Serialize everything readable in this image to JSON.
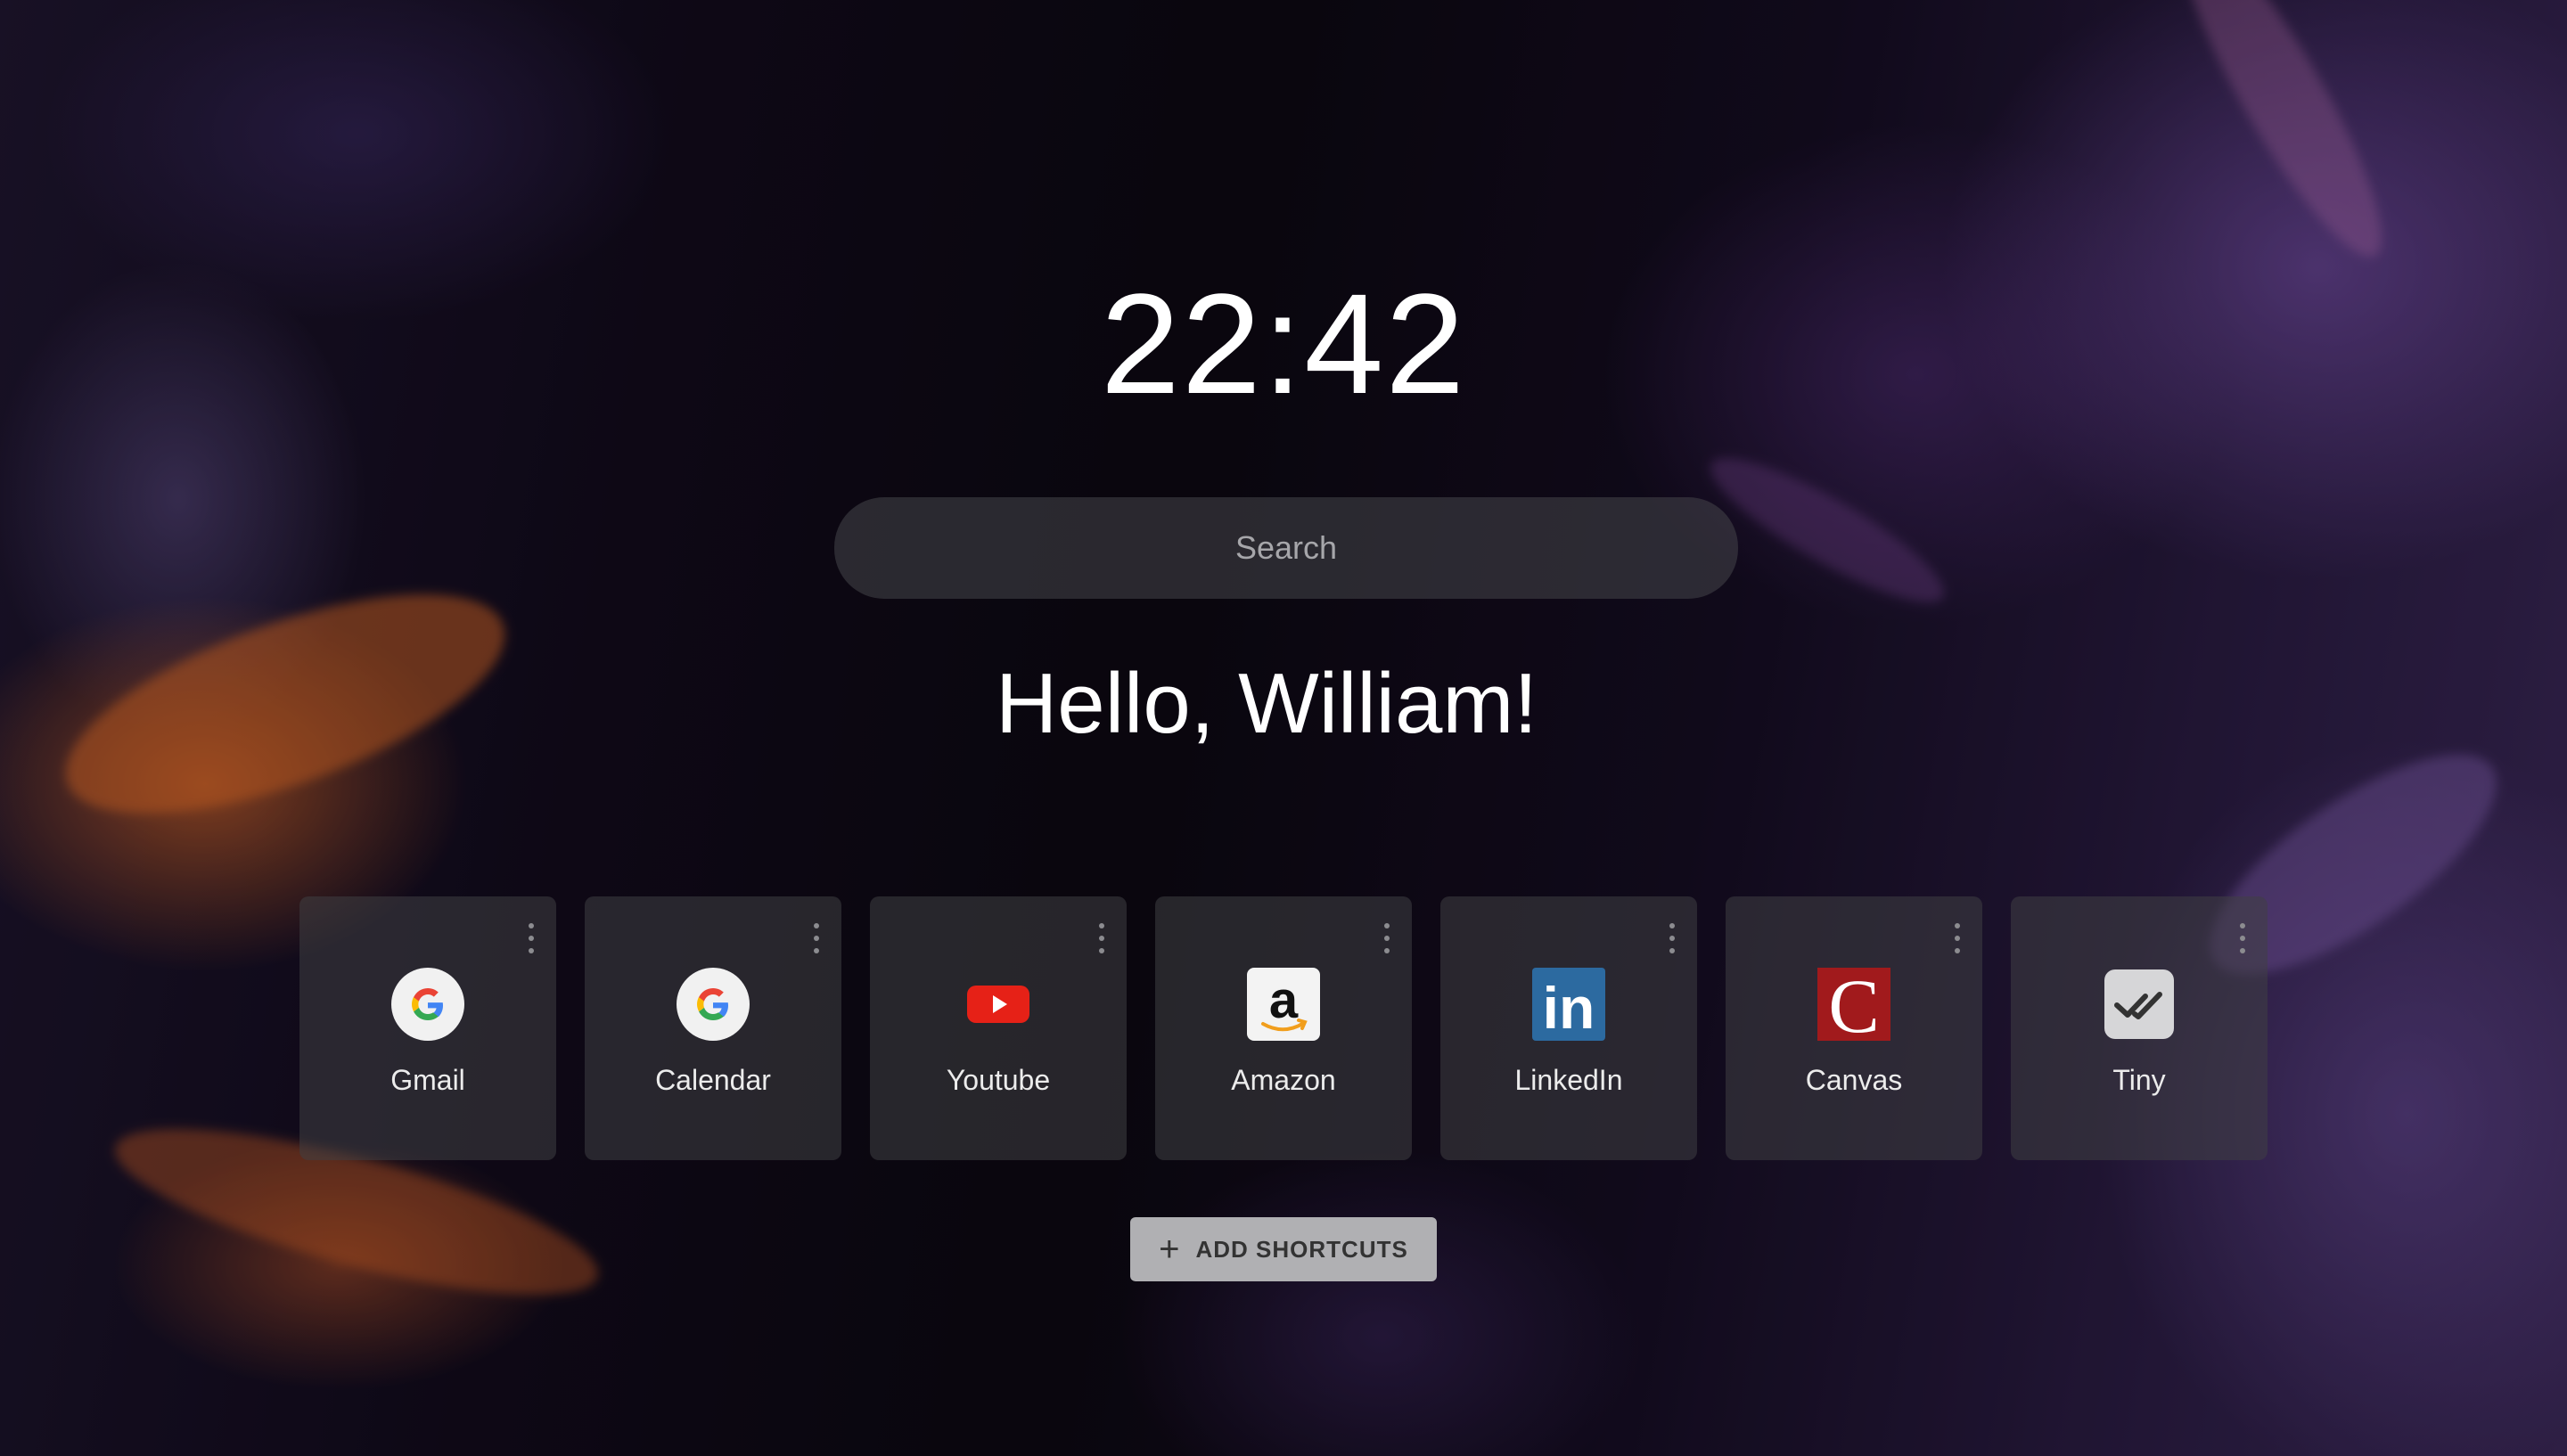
{
  "clock": {
    "time": "22:42"
  },
  "search": {
    "placeholder": "Search"
  },
  "greeting": {
    "text": "Hello, William!"
  },
  "shortcuts": [
    {
      "label": "Gmail",
      "icon": "google-g-icon"
    },
    {
      "label": "Calendar",
      "icon": "google-g-icon"
    },
    {
      "label": "Youtube",
      "icon": "youtube-icon"
    },
    {
      "label": "Amazon",
      "icon": "amazon-icon"
    },
    {
      "label": "LinkedIn",
      "icon": "linkedin-icon"
    },
    {
      "label": "Canvas",
      "icon": "canvas-icon"
    },
    {
      "label": "Tiny",
      "icon": "tiny-checkmark-icon"
    }
  ],
  "add_shortcuts": {
    "label": "ADD SHORTCUTS"
  },
  "colors": {
    "youtube_red": "#e62117",
    "linkedin_blue": "#2c6aa0",
    "canvas_red": "#a11a1c",
    "button_bg": "#b0b0b3"
  }
}
